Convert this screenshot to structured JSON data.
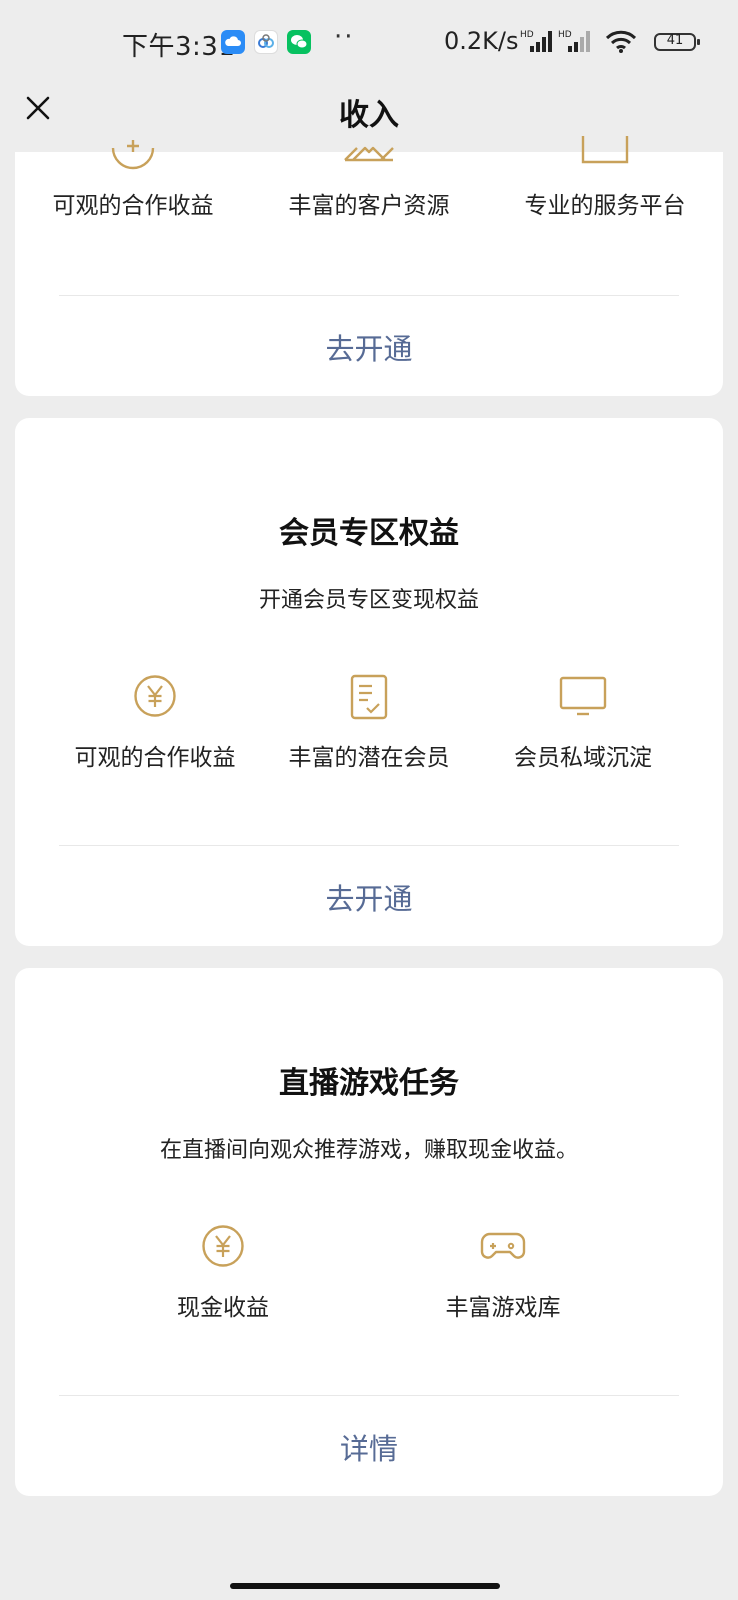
{
  "statusbar": {
    "time": "下午3:31",
    "speed": "0.2K/s",
    "signal1_tag": "HD",
    "signal2_tag": "HD",
    "battery": "41"
  },
  "nav": {
    "title": "收入",
    "close_icon": "close-icon"
  },
  "card1": {
    "features": [
      {
        "label": "可观的合作收益",
        "icon": "coin-icon"
      },
      {
        "label": "丰富的客户资源",
        "icon": "people-icon"
      },
      {
        "label": "专业的服务平台",
        "icon": "monitor-icon"
      }
    ],
    "action": "去开通"
  },
  "card2": {
    "title": "会员专区权益",
    "subtitle": "开通会员专区变现权益",
    "features": [
      {
        "label": "可观的合作收益",
        "icon": "yen-coin-icon"
      },
      {
        "label": "丰富的潜在会员",
        "icon": "document-check-icon"
      },
      {
        "label": "会员私域沉淀",
        "icon": "monitor-icon"
      }
    ],
    "action": "去开通"
  },
  "card3": {
    "title": "直播游戏任务",
    "subtitle": "在直播间向观众推荐游戏，赚取现金收益。",
    "features": [
      {
        "label": "现金收益",
        "icon": "yen-coin-icon"
      },
      {
        "label": "丰富游戏库",
        "icon": "gamepad-icon"
      }
    ],
    "action": "详情"
  },
  "colors": {
    "accent_gold": "#c8a15a",
    "link_blue": "#576b95",
    "background": "#ededed"
  }
}
